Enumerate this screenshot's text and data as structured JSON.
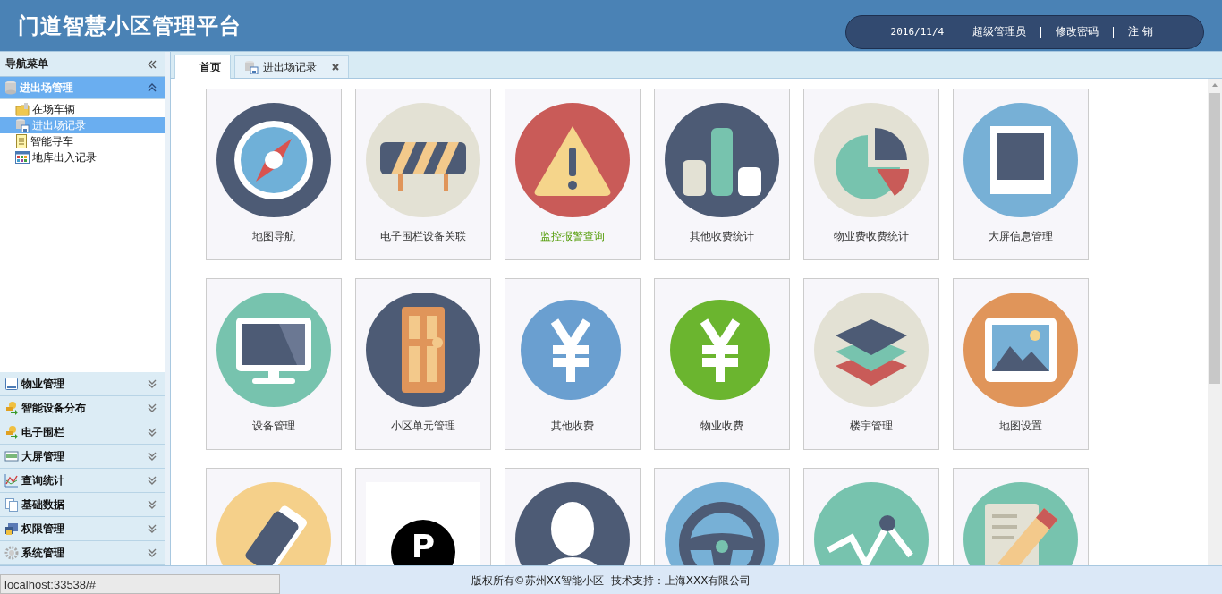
{
  "header": {
    "title": "门道智慧小区管理平台",
    "date": "2016/11/4",
    "user": "超级管理员",
    "links": [
      "修改密码",
      "注 销"
    ]
  },
  "sidebar": {
    "title": "导航菜单",
    "groups": [
      {
        "label": "进出场管理",
        "expanded": true,
        "items": [
          {
            "label": "在场车辆",
            "selected": false
          },
          {
            "label": "进出场记录",
            "selected": true
          },
          {
            "label": "智能寻车",
            "selected": false
          },
          {
            "label": "地库出入记录",
            "selected": false
          }
        ]
      },
      {
        "label": "物业管理",
        "expanded": false
      },
      {
        "label": "智能设备分布",
        "expanded": false
      },
      {
        "label": "电子围栏",
        "expanded": false
      },
      {
        "label": "大屏管理",
        "expanded": false
      },
      {
        "label": "查询统计",
        "expanded": false
      },
      {
        "label": "基础数据",
        "expanded": false
      },
      {
        "label": "权限管理",
        "expanded": false
      },
      {
        "label": "系统管理",
        "expanded": false
      }
    ]
  },
  "tabs": [
    {
      "label": "首页",
      "selected": true
    },
    {
      "label": "进出场记录",
      "selected": false
    }
  ],
  "tiles": [
    {
      "kind": "compass",
      "label": "地图导航",
      "highlighted": false
    },
    {
      "kind": "barrier",
      "label": "电子围栏设备关联",
      "highlighted": false
    },
    {
      "kind": "warning",
      "label": "监控报警查询",
      "highlighted": true
    },
    {
      "kind": "bars",
      "label": "其他收费统计",
      "highlighted": false
    },
    {
      "kind": "pie",
      "label": "物业费收费统计",
      "highlighted": false
    },
    {
      "kind": "screen",
      "label": "大屏信息管理",
      "highlighted": false
    },
    {
      "kind": "monitor",
      "label": "设备管理",
      "highlighted": false
    },
    {
      "kind": "door",
      "label": "小区单元管理",
      "highlighted": false
    },
    {
      "kind": "yen",
      "color": "#6a9fd0",
      "label": "其他收费",
      "highlighted": false
    },
    {
      "kind": "yen",
      "color": "#6bb52f",
      "label": "物业收费",
      "highlighted": false
    },
    {
      "kind": "layers",
      "label": "楼宇管理",
      "highlighted": false
    },
    {
      "kind": "picture",
      "label": "地图设置",
      "highlighted": false
    },
    {
      "kind": "card"
    },
    {
      "kind": "parking",
      "icon_text": "P"
    },
    {
      "kind": "person"
    },
    {
      "kind": "wheel"
    },
    {
      "kind": "trend"
    },
    {
      "kind": "edit"
    }
  ],
  "footer": "版权所有©苏州XX智能小区  技术支持：上海XXX有限公司",
  "status_url": "localhost:33538/#"
}
